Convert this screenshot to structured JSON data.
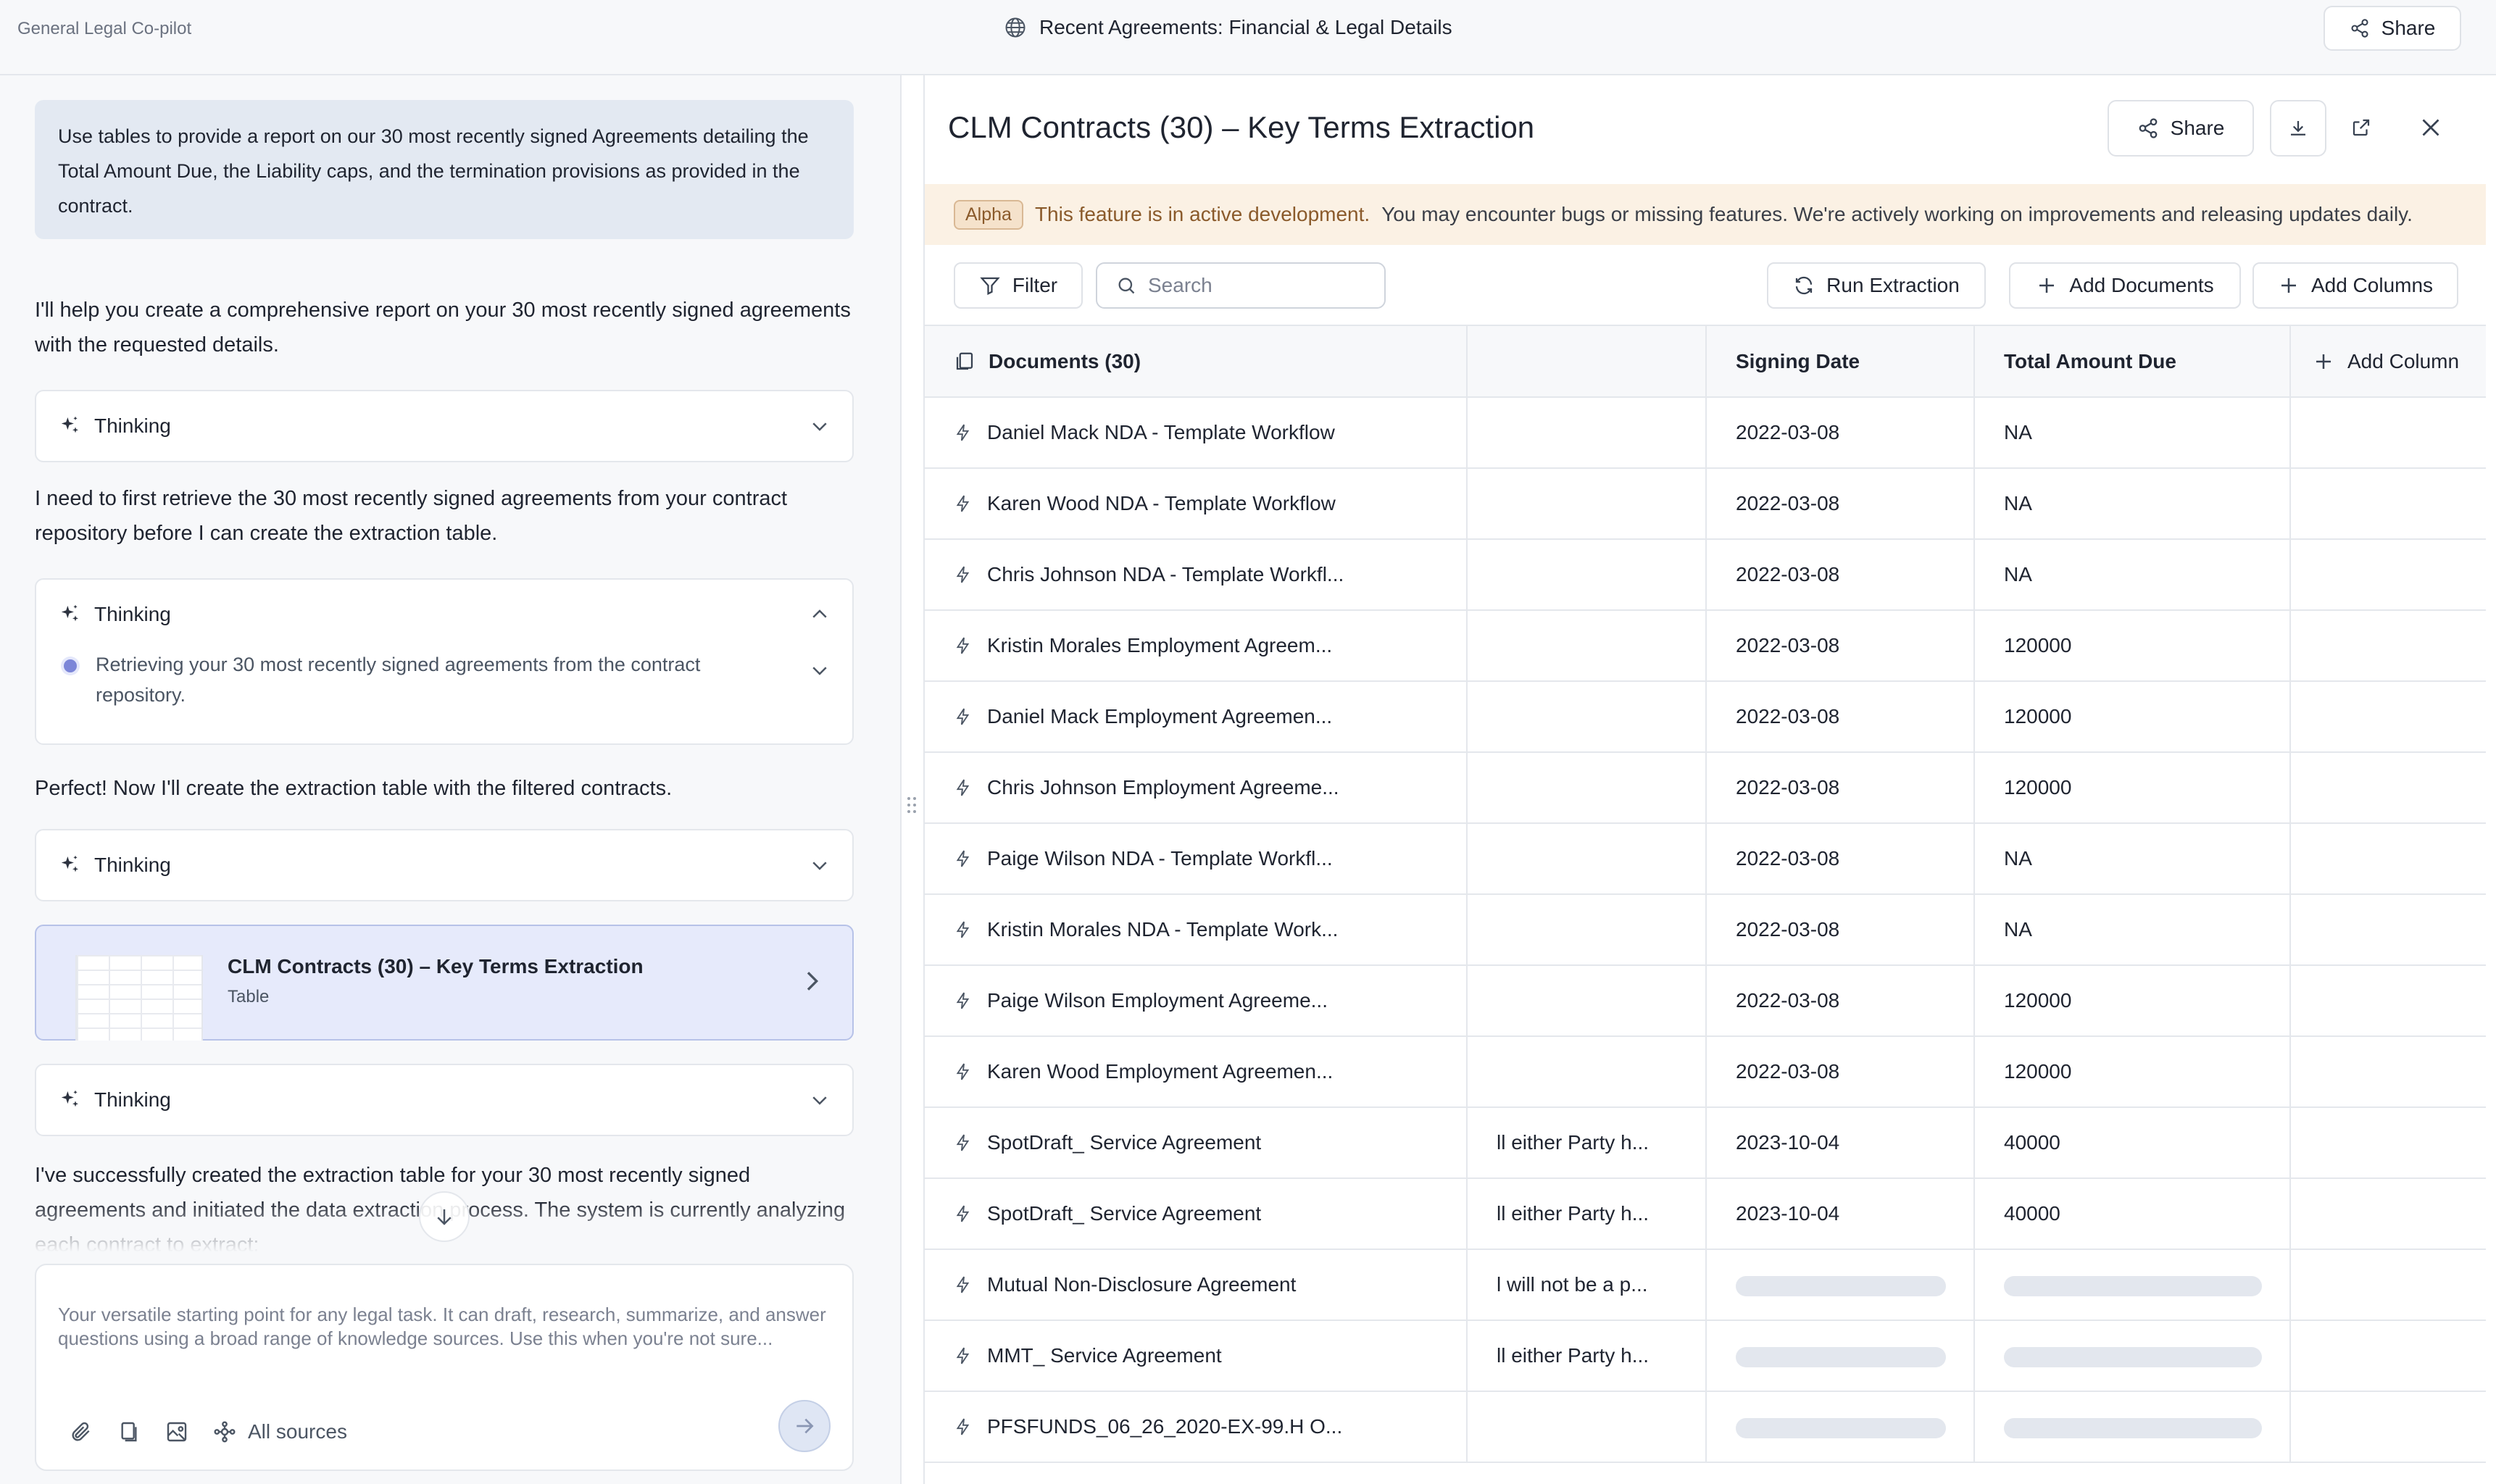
{
  "app": {
    "name": "General Legal Co-pilot"
  },
  "header": {
    "title": "Recent Agreements: Financial & Legal Details",
    "share_label": "Share"
  },
  "chat": {
    "user_message": "Use tables to provide a report on our 30 most recently signed Agreements detailing the Total Amount Due, the Liability caps, and the termination provisions as provided in the contract.",
    "reply_1": "I'll help you create a comprehensive report on your 30 most recently signed agreements with the requested details.",
    "thinking_label": "Thinking",
    "reply_2": "I need to first retrieve the 30 most recently signed agreements from your contract repository before I can create the extraction table.",
    "thinking_step": "Retrieving your 30 most recently signed agreements from the contract repository.",
    "reply_3": "Perfect! Now I'll create the extraction table with the filtered contracts.",
    "artifact": {
      "title": "CLM Contracts (30) – Key Terms Extraction",
      "type": "Table"
    },
    "reply_4": "I've successfully created the extraction table for your 30 most recently signed agreements and initiated the data extraction process. The system is currently analyzing each contract to extract:"
  },
  "composer": {
    "placeholder": "Your versatile starting point for any legal task. It can draft, research, summarize, and answer questions using a broad range of knowledge sources. Use this when you're not sure...",
    "sources_label": "All sources"
  },
  "panel": {
    "title": "CLM Contracts (30) – Key Terms Extraction",
    "share_label": "Share",
    "alpha": {
      "badge": "Alpha",
      "strong": "This feature is in active development.",
      "rest": "You may encounter bugs or missing features. We're actively working on improvements and releasing updates daily."
    },
    "toolbar": {
      "filter": "Filter",
      "search_placeholder": "Search",
      "run": "Run Extraction",
      "add_docs": "Add Documents",
      "add_cols": "Add Columns"
    },
    "columns": {
      "documents": "Documents (30)",
      "middle": "",
      "signing_date": "Signing Date",
      "total_amount": "Total Amount Due",
      "add_column": "Add Column"
    },
    "rows": [
      {
        "doc": "Daniel Mack NDA - Template Workflow",
        "mid": "",
        "date": "2022-03-08",
        "amount": "NA"
      },
      {
        "doc": "Karen Wood NDA - Template Workflow",
        "mid": "",
        "date": "2022-03-08",
        "amount": "NA"
      },
      {
        "doc": "Chris Johnson NDA - Template Workfl...",
        "mid": "",
        "date": "2022-03-08",
        "amount": "NA"
      },
      {
        "doc": "Kristin Morales Employment Agreem...",
        "mid": "",
        "date": "2022-03-08",
        "amount": "120000"
      },
      {
        "doc": "Daniel Mack Employment Agreemen...",
        "mid": "",
        "date": "2022-03-08",
        "amount": "120000"
      },
      {
        "doc": "Chris Johnson Employment Agreeme...",
        "mid": "",
        "date": "2022-03-08",
        "amount": "120000"
      },
      {
        "doc": "Paige Wilson NDA - Template Workfl...",
        "mid": "",
        "date": "2022-03-08",
        "amount": "NA"
      },
      {
        "doc": "Kristin Morales NDA - Template Work...",
        "mid": "",
        "date": "2022-03-08",
        "amount": "NA"
      },
      {
        "doc": "Paige Wilson Employment Agreeme...",
        "mid": "",
        "date": "2022-03-08",
        "amount": "120000"
      },
      {
        "doc": "Karen Wood Employment Agreemen...",
        "mid": "",
        "date": "2022-03-08",
        "amount": "120000"
      },
      {
        "doc": "SpotDraft_ Service Agreement",
        "mid": "ll either Party h...",
        "date": "2023-10-04",
        "amount": "40000"
      },
      {
        "doc": "SpotDraft_ Service Agreement",
        "mid": "ll either Party h...",
        "date": "2023-10-04",
        "amount": "40000"
      },
      {
        "doc": "Mutual Non-Disclosure Agreement",
        "mid": "l will not be a p...",
        "date": "",
        "amount": ""
      },
      {
        "doc": "MMT_ Service Agreement",
        "mid": "ll either Party h...",
        "date": "",
        "amount": ""
      },
      {
        "doc": "PFSFUNDS_06_26_2020-EX-99.H O...",
        "mid": "",
        "date": "",
        "amount": ""
      }
    ]
  },
  "colors": {
    "accent": "#7c86d8",
    "alpha_bg": "#fbf1e4",
    "artifact_bg": "#e6eafb"
  }
}
